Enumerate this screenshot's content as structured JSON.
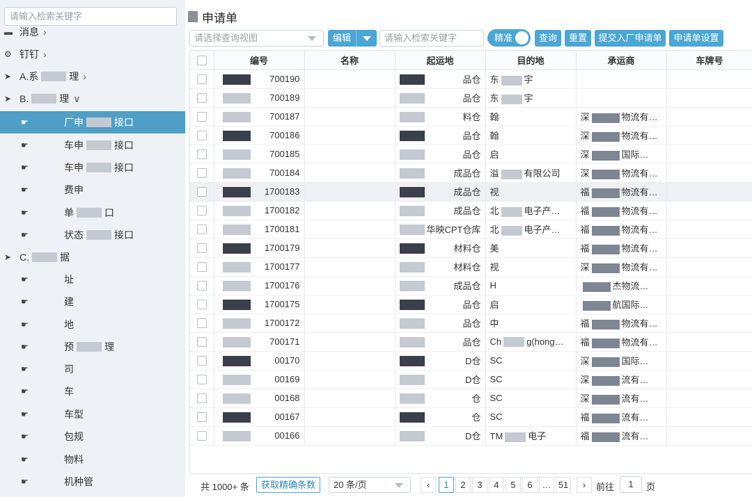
{
  "sidebar": {
    "search_placeholder": "请输入检索关键字",
    "items": [
      {
        "label": "消息",
        "icon": "chat-icon"
      },
      {
        "label": "钉钉",
        "icon": "gears-icon"
      },
      {
        "label": "A.系",
        "suffix": "理",
        "icon": "rocket-icon"
      },
      {
        "label": "B.",
        "suffix": "理",
        "icon": "rocket-icon"
      },
      {
        "label": "厂申",
        "suffix": "接口",
        "icon": "hand-pointer-icon"
      },
      {
        "label": "车申",
        "suffix": "接口",
        "icon": "hand-pointer-icon"
      },
      {
        "label": "车申",
        "suffix": "接口",
        "icon": "hand-pointer-icon"
      },
      {
        "label": "费申",
        "suffix": "",
        "icon": "hand-pointer-icon"
      },
      {
        "label": "单",
        "suffix": "口",
        "icon": "hand-pointer-icon"
      },
      {
        "label": "状态",
        "suffix": "接口",
        "icon": "hand-pointer-icon"
      },
      {
        "label": "C.",
        "suffix": "据",
        "icon": "rocket-icon"
      },
      {
        "label": "址",
        "icon": "hand-pointer-icon"
      },
      {
        "label": "建",
        "icon": "hand-pointer-icon"
      },
      {
        "label": "地",
        "icon": "hand-pointer-icon"
      },
      {
        "label": "预",
        "suffix": "理",
        "icon": "hand-pointer-icon"
      },
      {
        "label": "司",
        "icon": "hand-pointer-icon"
      },
      {
        "label": "车",
        "icon": "hand-pointer-icon"
      },
      {
        "label": "车型",
        "icon": "hand-pointer-icon"
      },
      {
        "label": "包规",
        "icon": "hand-pointer-icon"
      },
      {
        "label": "物料",
        "icon": "hand-pointer-icon"
      },
      {
        "label": "机种管",
        "icon": "hand-pointer-icon"
      }
    ]
  },
  "header": {
    "title": "申请单"
  },
  "toolbar": {
    "view_placeholder": "请选择查询视图",
    "edit_label": "编辑",
    "keyword_placeholder": "请输入检索关键字",
    "exact_label": "精准",
    "query_label": "查询",
    "reset_label": "重置",
    "submit_label": "提交入厂申请单",
    "settings_label": "申请单设置"
  },
  "table": {
    "columns": [
      "编号",
      "名称",
      "起运地",
      "目的地",
      "承运商",
      "车牌号"
    ],
    "rows": [
      [
        "700190",
        "",
        "品仓",
        "东",
        "",
        ""
      ],
      [
        "700189",
        "",
        "品仓",
        "东",
        "",
        ""
      ],
      [
        "700187",
        "",
        "料仓",
        "翰",
        "深",
        ""
      ],
      [
        "700186",
        "",
        "品仓",
        "翰",
        "深",
        ""
      ],
      [
        "700185",
        "",
        "品仓",
        "启",
        "深",
        ""
      ],
      [
        "700184",
        "",
        "成品仓",
        "溢",
        "深",
        ""
      ],
      [
        "1700183",
        "",
        "成品仓",
        "视",
        "福",
        ""
      ],
      [
        "1700182",
        "",
        "成品仓",
        "北",
        "福",
        ""
      ],
      [
        "1700181",
        "",
        "华映CPT仓库",
        "北",
        "福",
        ""
      ],
      [
        "1700179",
        "",
        "材料仓",
        "美",
        "福",
        ""
      ],
      [
        "1700177",
        "",
        "材料仓",
        "视",
        "深",
        ""
      ],
      [
        "1700176",
        "",
        "成品仓",
        "H",
        "",
        ""
      ],
      [
        "1700175",
        "",
        "品仓",
        "启",
        "",
        ""
      ],
      [
        "1700172",
        "",
        "品仓",
        "中",
        "福",
        ""
      ],
      [
        "700171",
        "",
        "品仓",
        "Ch",
        "福",
        ""
      ],
      [
        "00170",
        "",
        "D仓",
        "SC",
        "深",
        ""
      ],
      [
        "00169",
        "",
        "D仓",
        "SC",
        "深",
        ""
      ],
      [
        "00168",
        "",
        "仓",
        "SC",
        "深",
        ""
      ],
      [
        "00167",
        "",
        "仓",
        "SC",
        "福",
        ""
      ],
      [
        "00166",
        "",
        "D仓",
        "TM",
        "福",
        ""
      ]
    ],
    "extra_dest": [
      "宇",
      "宇",
      "",
      "",
      "",
      "有限公司",
      "",
      "电子产…",
      "电子产…",
      "",
      "",
      "",
      "",
      "",
      "g(hong…",
      "",
      "",
      "",
      "",
      "电子"
    ],
    "extra_carrier": [
      "",
      "",
      "物流有…",
      "物流有…",
      "国际…",
      "物流有…",
      "物流有…",
      "物流有…",
      "物流有…",
      "物流有…",
      "物流有…",
      "杰物流…",
      "航国际…",
      "物流有…",
      "物流有…",
      "国际…",
      "流有…",
      "流有…",
      "流有…",
      "流有…"
    ]
  },
  "footer": {
    "total": "共 1000+ 条",
    "exact_count": "获取精确条数",
    "page_size": "20 条/页",
    "pages": [
      "1",
      "2",
      "3",
      "4",
      "5",
      "6",
      "…",
      "51"
    ],
    "goto_label": "前往",
    "page_input": "1",
    "page_suffix": "页"
  }
}
